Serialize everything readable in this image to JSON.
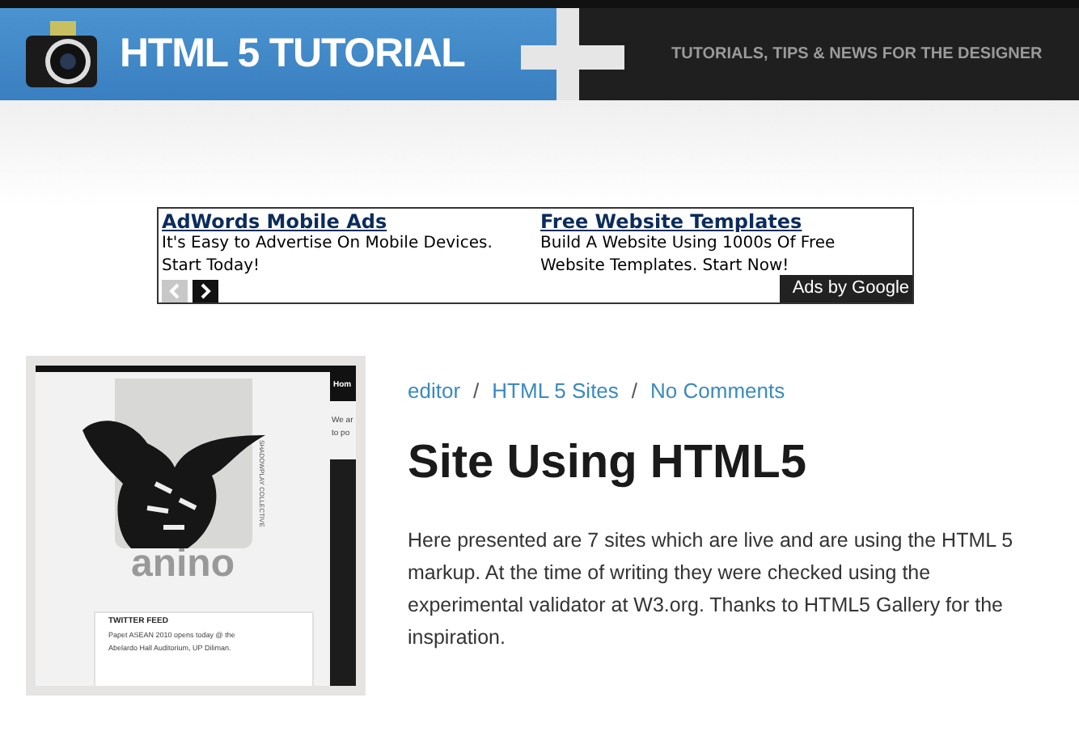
{
  "header": {
    "logo": "HTML 5 TUTORIAL",
    "tagline": "TUTORIALS, TIPS & NEWS FOR THE DESIGNER"
  },
  "ads": {
    "items": [
      {
        "title": "AdWords Mobile Ads",
        "text": "It's Easy to Advertise On Mobile Devices. Start Today!"
      },
      {
        "title": "Free Website Templates",
        "text": "Build A Website Using 1000s Of Free Website Templates. Start Now!"
      }
    ],
    "prev_disabled": true,
    "next_disabled": false,
    "badge": "Ads by Google"
  },
  "post": {
    "thumbnail": {
      "nav": "Hom",
      "intro_lines": [
        "We ar",
        "to po"
      ],
      "brand": "anino",
      "brand_sub": "SHADOWPLAY COLLECTIVE",
      "feed_title": "TWITTER FEED",
      "feed_lines": [
        "Papet ASEAN 2010 opens today @ the",
        "Abelardo Hall Auditorium, UP Diliman."
      ]
    },
    "meta": [
      "editor",
      "HTML 5 Sites",
      "No Comments"
    ],
    "meta_separator": "/",
    "title": "Site Using HTML5",
    "body": "Here presented are 7 sites which are live and are using the HTML 5 markup. At the time of writing they were checked using the experimental validator at W3.org. Thanks to HTML5 Gallery for the inspiration."
  }
}
